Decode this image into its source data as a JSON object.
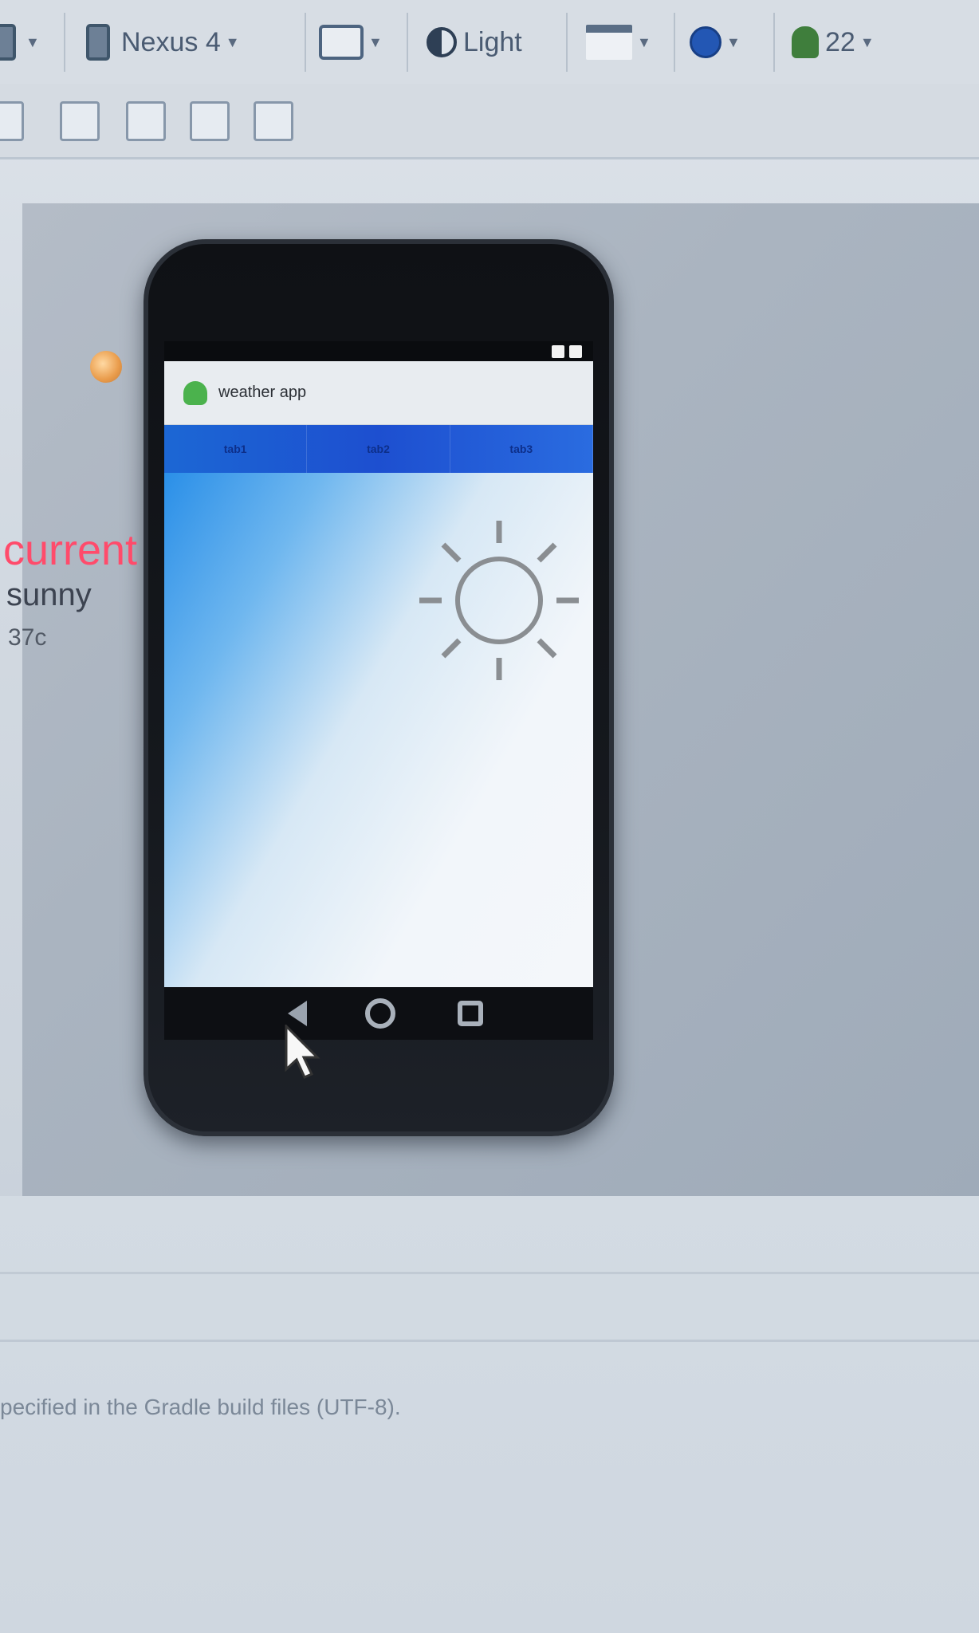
{
  "toolbar": {
    "device_label": "Nexus 4",
    "theme_label": "Light",
    "api_level": "22",
    "icons": {
      "device": "phone-icon",
      "orientation": "orientation-icon",
      "theme": "theme-icon",
      "activity": "activity-icon",
      "locale": "globe-icon",
      "api": "android-icon"
    }
  },
  "toolbar2": {
    "icons": [
      "layout-icon",
      "chart-icon",
      "warning-icon",
      "image-icon",
      "person-icon"
    ]
  },
  "phone": {
    "app_title": "weather app",
    "tabs": [
      "tab1",
      "tab2",
      "tab3"
    ],
    "labels": {
      "current": "current",
      "condition": "sunny",
      "temperature": "37c"
    },
    "icons": {
      "sun": "sun-icon",
      "back": "back-icon",
      "home": "home-icon",
      "recent": "recent-apps-icon"
    },
    "colors": {
      "tab_bar": "#1d4fd0",
      "current_text": "#ff4b6b",
      "content_gradient_start": "#2a8fe8"
    }
  },
  "status": {
    "message": "pecified in the Gradle build files (UTF-8)."
  }
}
